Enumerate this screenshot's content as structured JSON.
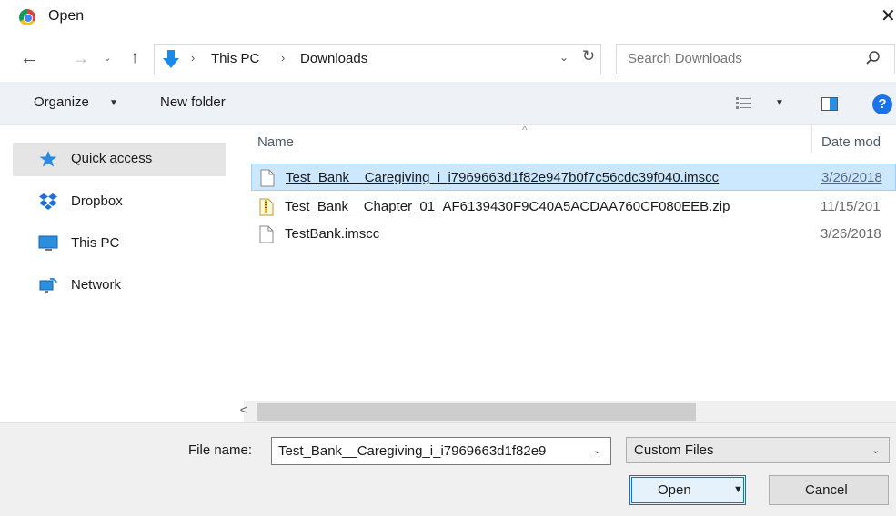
{
  "window": {
    "title": "Open",
    "close": "✕"
  },
  "nav": {
    "back": "←",
    "forward": "→",
    "recent": "⌄",
    "up": "↑",
    "breadcrumb": [
      "This PC",
      "Downloads"
    ],
    "separator": "›",
    "dropdown": "⌄",
    "refresh": "↻"
  },
  "search": {
    "placeholder": "Search Downloads"
  },
  "toolbar": {
    "organize_label": "Organize",
    "organize_caret": "▼",
    "new_folder_label": "New folder",
    "view_caret": "▼",
    "help": "?"
  },
  "sidebar": {
    "items": [
      {
        "label": "Quick access",
        "icon": "star-icon",
        "selected": true
      },
      {
        "label": "Dropbox",
        "icon": "dropbox-icon"
      },
      {
        "label": "This PC",
        "icon": "monitor-icon"
      },
      {
        "label": "Network",
        "icon": "network-icon"
      }
    ]
  },
  "filelist": {
    "sort_arrow": "^",
    "columns": [
      "Name",
      "Date mod"
    ],
    "rows": [
      {
        "name": "Test_Bank__Caregiving_i_i7969663d1f82e947b0f7c56cdc39f040.imscc",
        "date": "3/26/2018",
        "icon": "file-icon",
        "selected": true
      },
      {
        "name": "Test_Bank__Chapter_01_AF6139430F9C40A5ACDAA760CF080EEB.zip",
        "date": "11/15/201",
        "icon": "zip-icon"
      },
      {
        "name": "TestBank.imscc",
        "date": "3/26/2018",
        "icon": "file-icon"
      }
    ]
  },
  "scrollbar": {
    "left_arrow": "<"
  },
  "bottom": {
    "filename_label": "File name:",
    "filename_value": "Test_Bank__Caregiving_i_i7969663d1f82e9",
    "filename_caret": "⌄",
    "filetype_value": "Custom Files",
    "filetype_caret": "⌄",
    "open_label": "Open",
    "open_caret": "▼",
    "cancel_label": "Cancel"
  },
  "colors": {
    "accent": "#0078d7",
    "selection": "#cce8ff",
    "command_bar": "#eef1f6"
  }
}
